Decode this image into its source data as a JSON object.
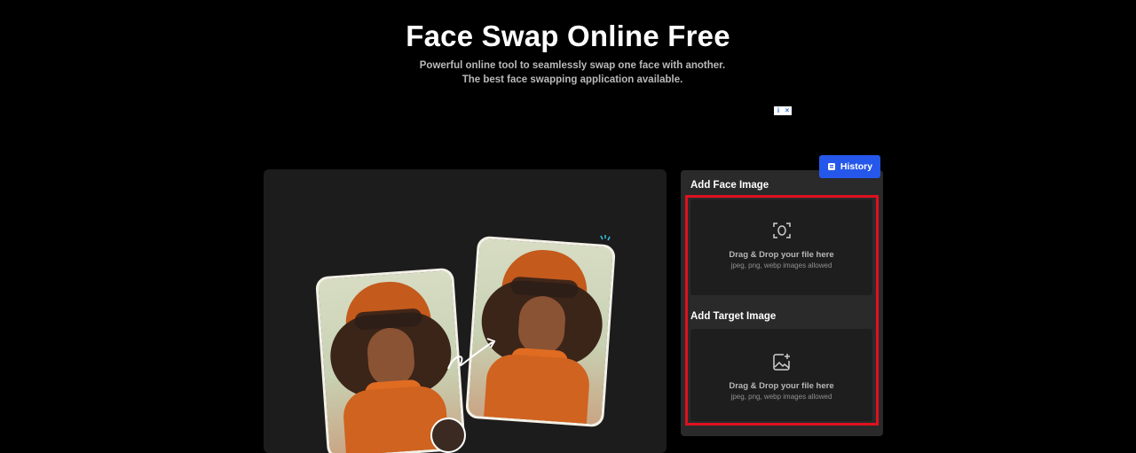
{
  "hero": {
    "title": "Face Swap Online Free",
    "subtitle": "Powerful online tool to seamlessly swap one face with another. The best face swapping application available."
  },
  "ad": {
    "info_icon": "info-icon",
    "close_icon": "close-icon",
    "info_glyph": "i",
    "close_glyph": "×"
  },
  "toolbar": {
    "history_label": "History",
    "history_icon": "history-icon",
    "accent": "#2557ea"
  },
  "uploads": {
    "face": {
      "label": "Add Face Image",
      "title": "Drag & Drop your file here",
      "subtitle": "jpeg, png, webp images allowed",
      "icon": "face-scan-icon"
    },
    "target": {
      "label": "Add Target Image",
      "title": "Drag & Drop your file here",
      "subtitle": "jpeg, png, webp images allowed",
      "icon": "image-add-icon"
    }
  },
  "preview": {
    "illustration": "face-swap-example",
    "arrow_icon": "swap-arrow-icon"
  },
  "colors": {
    "background": "#000000",
    "panel": "#1c1c1c",
    "highlight": "#e0111f"
  }
}
